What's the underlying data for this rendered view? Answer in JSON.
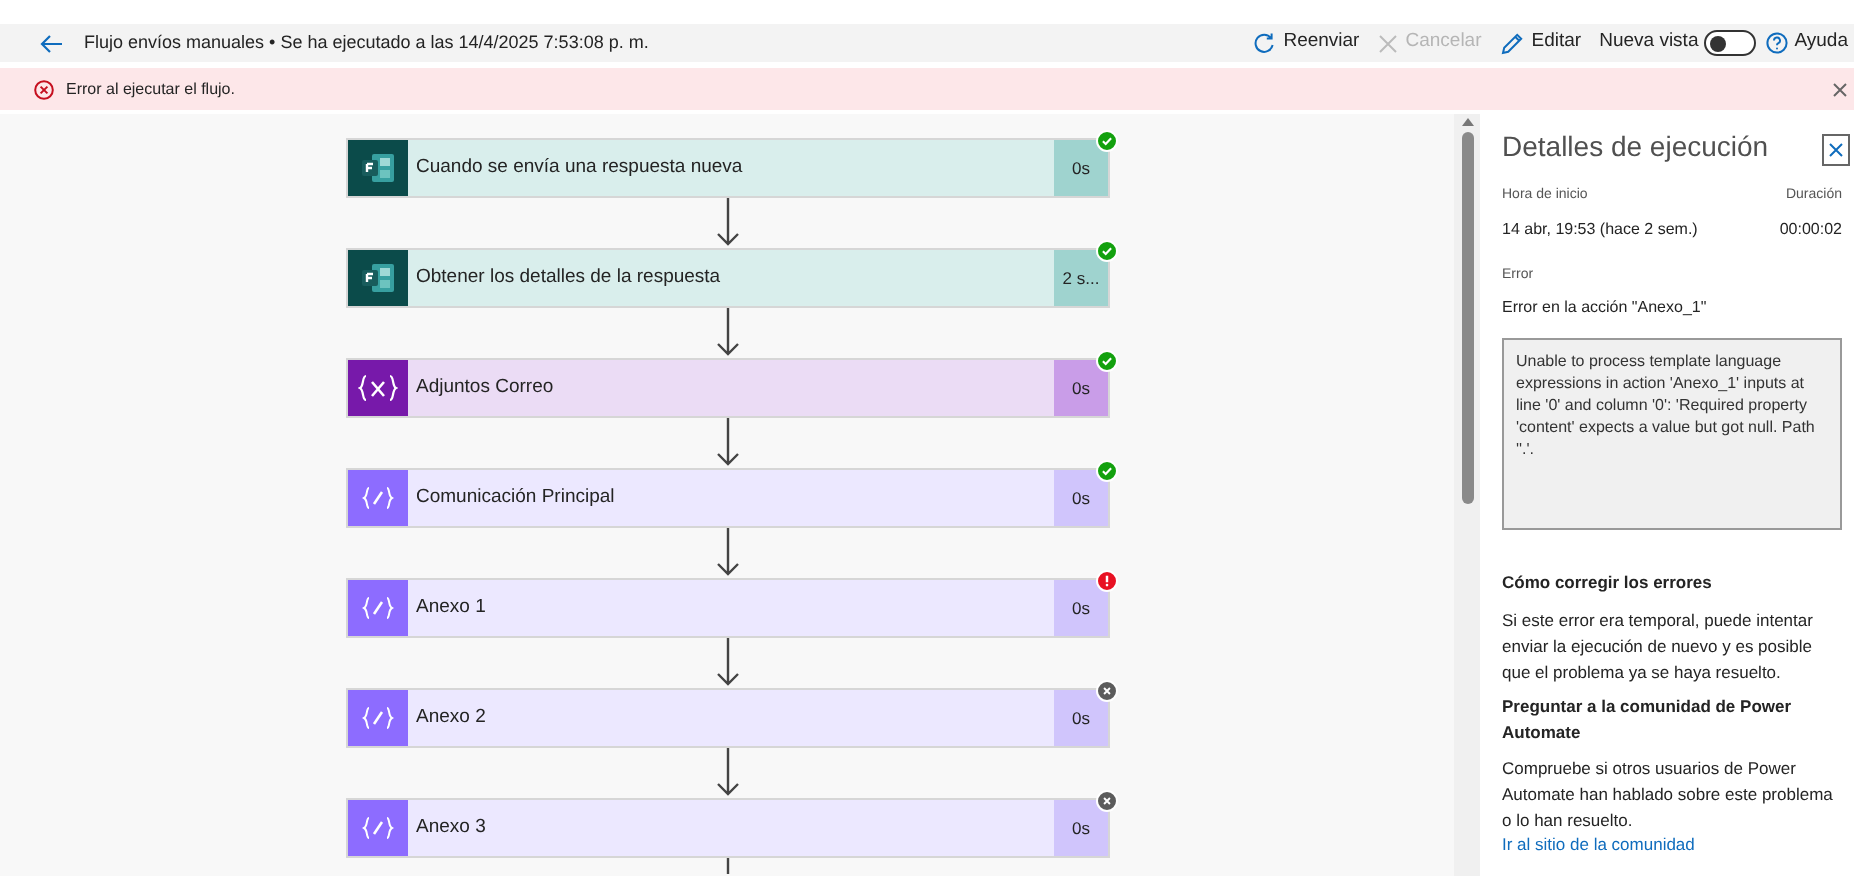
{
  "header": {
    "title": "Flujo envíos manuales • Se ha ejecutado a las 14/4/2025 7:53:08 p. m.",
    "actions": [
      {
        "label": "Reenviar",
        "kind": "resubmit",
        "disabled": false
      },
      {
        "label": "Cancelar",
        "kind": "cancel",
        "disabled": true
      },
      {
        "label": "Editar",
        "kind": "edit",
        "disabled": false
      }
    ],
    "toggle": {
      "label": "Nueva vista",
      "on": false
    },
    "help": "Ayuda"
  },
  "error_banner": {
    "message": "Error al ejecutar el flujo."
  },
  "steps": [
    {
      "title": "Cuando se envía una respuesta nueva",
      "duration": "0s",
      "kind": "forms",
      "succeeded": true,
      "failed": false,
      "skipped": false
    },
    {
      "title": "Obtener los detalles de la respuesta",
      "duration": "2 s...",
      "kind": "forms",
      "succeeded": true,
      "failed": false,
      "skipped": false
    },
    {
      "title": "Adjuntos Correo",
      "duration": "0s",
      "kind": "variable",
      "succeeded": true,
      "failed": false,
      "skipped": false
    },
    {
      "title": "Comunicación Principal",
      "duration": "0s",
      "kind": "compose",
      "succeeded": true,
      "failed": false,
      "skipped": false
    },
    {
      "title": "Anexo 1",
      "duration": "0s",
      "kind": "compose",
      "succeeded": false,
      "failed": true,
      "skipped": false
    },
    {
      "title": "Anexo 2",
      "duration": "0s",
      "kind": "compose",
      "succeeded": false,
      "failed": false,
      "skipped": true
    },
    {
      "title": "Anexo 3",
      "duration": "0s",
      "kind": "compose",
      "succeeded": false,
      "failed": false,
      "skipped": true
    }
  ],
  "panel": {
    "title": "Detalles de ejecución",
    "start_label": "Hora de inicio",
    "start_value": "14 abr, 19:53 (hace 2 sem.)",
    "duration_label": "Duración",
    "duration_value": "00:00:02",
    "error_label": "Error",
    "error_value": "Error en la acción \"Anexo_1\"",
    "error_detail": "Unable to process template language expressions in action 'Anexo_1' inputs at line '0' and column '0': 'Required property 'content' expects a value but got null. Path ''.'.",
    "fix_heading": "Cómo corregir los errores",
    "fix_text": "Si este error era temporal, puede intentar enviar la ejecución de nuevo y es posible que el problema ya se haya resuelto.",
    "community_heading": "Preguntar a la comunidad de Power Automate",
    "community_text": "Compruebe si otros usuarios de Power Automate han hablado sobre este problema o lo han resuelto.",
    "community_link": "Ir al sitio de la comunidad"
  }
}
